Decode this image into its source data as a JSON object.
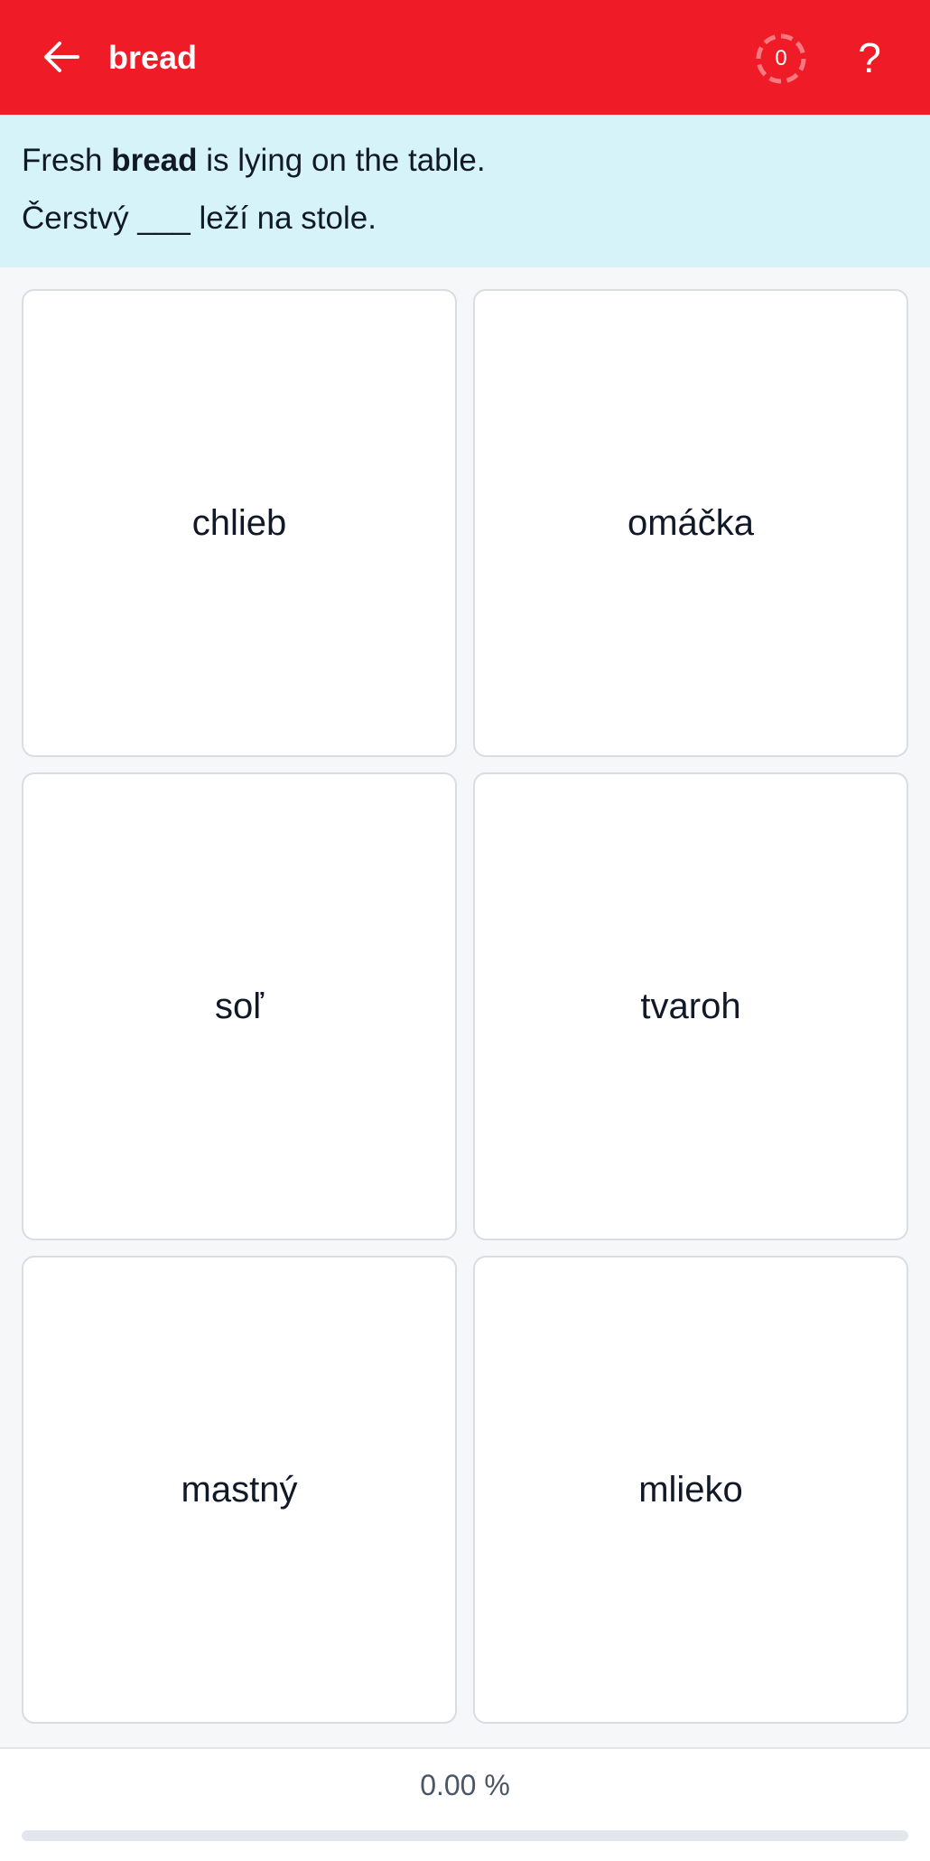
{
  "header": {
    "title": "bread",
    "back_icon": "arrow-left-icon",
    "counter_value": "0",
    "help_label": "?",
    "background_color": "#ef1c27"
  },
  "prompt": {
    "english_before": "Fresh ",
    "english_bold": "bread",
    "english_after": " is lying on the table.",
    "target_sentence": "Čerstvý ___ leží na stole.",
    "background_color": "#d5f3f8"
  },
  "options": [
    {
      "label": "chlieb"
    },
    {
      "label": "omáčka"
    },
    {
      "label": "soľ"
    },
    {
      "label": "tvaroh"
    },
    {
      "label": "mastný"
    },
    {
      "label": "mlieko"
    }
  ],
  "footer": {
    "progress_text": "0.00 %",
    "progress_fraction": 0
  }
}
